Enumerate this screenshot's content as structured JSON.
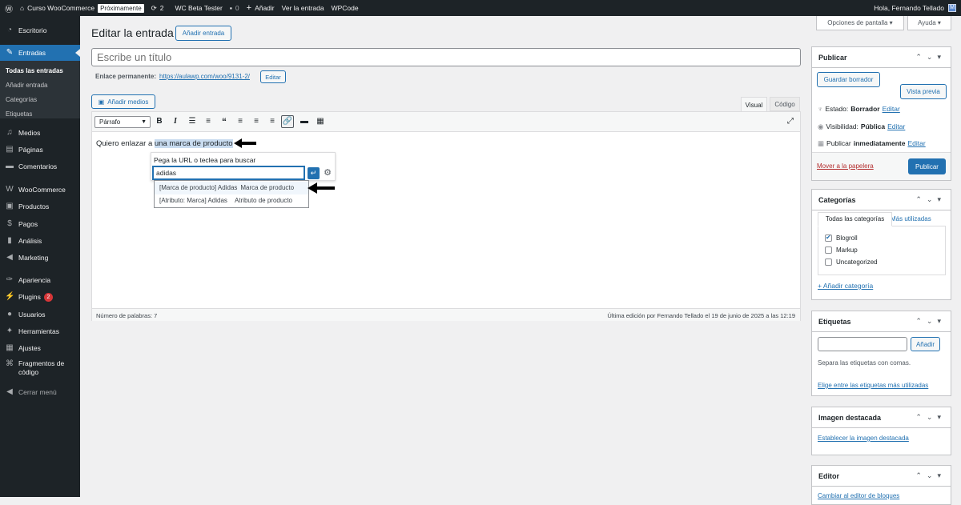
{
  "adminbar": {
    "site": "Curso WooCommerce",
    "site_badge": "Próximamente",
    "updates": "2",
    "beta": "WC Beta Tester",
    "comments": "0",
    "add": "Añadir",
    "view": "Ver la entrada",
    "wpcode": "WPCode",
    "greeting": "Hola, Fernando Tellado"
  },
  "sidebar": {
    "dashboard": "Escritorio",
    "entries": "Entradas",
    "sub": [
      "Todas las entradas",
      "Añadir entrada",
      "Categorías",
      "Etiquetas"
    ],
    "media": "Medios",
    "pages": "Páginas",
    "comments": "Comentarios",
    "woo": "WooCommerce",
    "products": "Productos",
    "payments": "Pagos",
    "analytics": "Análisis",
    "marketing": "Marketing",
    "appearance": "Apariencia",
    "plugins": "Plugins",
    "plugins_count": "2",
    "users": "Usuarios",
    "tools": "Herramientas",
    "settings": "Ajustes",
    "snippets": "Fragmentos de código",
    "collapse": "Cerrar menú"
  },
  "screen": {
    "options": "Opciones de pantalla ▾",
    "help": "Ayuda ▾"
  },
  "editor": {
    "heading": "Editar la entrada",
    "add_new": "Añadir entrada",
    "title_placeholder": "Escribe un título",
    "permalink_label": "Enlace permanente:",
    "permalink_url": "https://aulawp.com/woo/9131-2/",
    "permalink_edit": "Editar",
    "add_media": "Añadir medios",
    "tab_visual": "Visual",
    "tab_code": "Código",
    "format": "Párrafo",
    "body_text": "Quiero enlazar a ",
    "link_text": "una marca de producto",
    "word_count": "Número de palabras: 7",
    "last_edit": "Última edición por Fernando Tellado el 19 de junio de 2025 a las 12:19"
  },
  "linkpopup": {
    "hint": "Pega la URL o teclea para buscar",
    "query": "adidas",
    "results": [
      {
        "title": "[Marca de producto] Adidas",
        "type": "Marca de producto"
      },
      {
        "title": "[Atributo: Marca] Adidas",
        "type": "Atributo de producto"
      }
    ]
  },
  "publish": {
    "title": "Publicar",
    "save_draft": "Guardar borrador",
    "preview": "Vista previa",
    "status_label": "Estado:",
    "status_value": "Borrador",
    "visibility_label": "Visibilidad:",
    "visibility_value": "Pública",
    "publish_label": "Publicar",
    "publish_value": "inmediatamente",
    "edit": "Editar",
    "trash": "Mover a la papelera",
    "publish_btn": "Publicar"
  },
  "categories": {
    "title": "Categorías",
    "tab_all": "Todas las categorías",
    "tab_used": "Más utilizadas",
    "items": [
      "Blogroll",
      "Markup",
      "Uncategorized"
    ],
    "add": "+ Añadir categoría"
  },
  "tags": {
    "title": "Etiquetas",
    "add": "Añadir",
    "help": "Separa las etiquetas con comas.",
    "choose": "Elige entre las etiquetas más utilizadas"
  },
  "featured": {
    "title": "Imagen destacada",
    "set": "Establecer la imagen destacada"
  },
  "editorbox": {
    "title": "Editor",
    "switch": "Cambiar al editor de bloques"
  }
}
